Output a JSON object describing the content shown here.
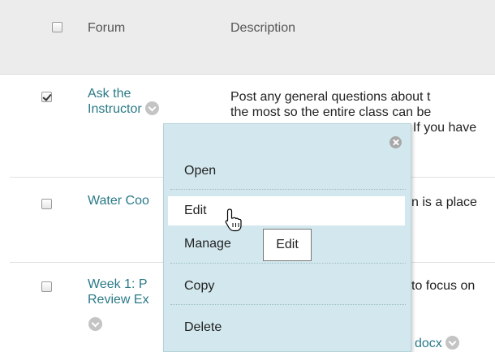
{
  "table": {
    "columns": {
      "forum": "Forum",
      "description": "Description"
    },
    "rows": [
      {
        "forum_line1": "Ask the",
        "forum_line2": "Instructor",
        "checked": true,
        "desc_line1": "Post any general questions about t",
        "desc_line2": "the most so the entire class can be",
        "desc_line3": ": If you have"
      },
      {
        "forum": "Water Coo",
        "checked": false,
        "desc_line1": "n is a place"
      },
      {
        "forum_line1": "Week 1: P",
        "forum_line2": "Review Ex",
        "checked": false,
        "desc_line1": "to focus on",
        "desc_line_bottom": "docx"
      }
    ]
  },
  "context_menu": {
    "items": [
      {
        "label": "Open"
      },
      {
        "label": "Edit",
        "hovered": true
      },
      {
        "label": "Manage"
      },
      {
        "label": "Copy"
      },
      {
        "label": "Delete"
      }
    ]
  },
  "tooltip": {
    "text": "Edit"
  },
  "icons": {
    "row_menu": "chevron-down-circle-icon",
    "close": "close-circle-icon",
    "cursor": "hand-pointer-icon"
  },
  "colors": {
    "link": "#2a7a87",
    "menu_bg": "#d3e8ee",
    "header_bg": "#ececec"
  }
}
